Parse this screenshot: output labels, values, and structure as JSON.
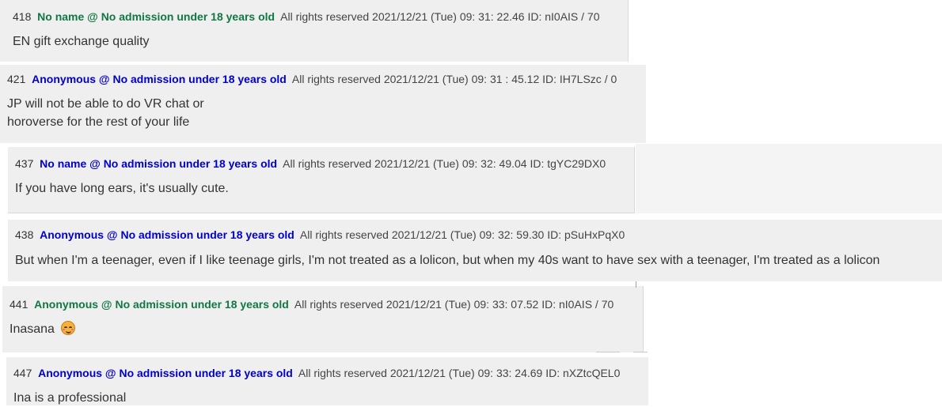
{
  "posts": [
    {
      "number": "418",
      "name": "No name @ No admission under 18 years old",
      "name_color": "#117743",
      "meta": "All rights reserved 2021/12/21 (Tue) 09: 31: 22.46  ID: nI0AIS / 70",
      "lines": [
        "EN gift exchange quality"
      ]
    },
    {
      "number": "421",
      "name": "Anonymous @ No admission under 18 years old",
      "name_color": "#0000cc",
      "meta": "All rights reserved 2021/12/21 (Tue) 09: 31  : 45.12 ID: IH7LSzc / 0",
      "lines": [
        "JP will not be able to do VR chat or",
        "horoverse for the rest of your life"
      ]
    },
    {
      "number": "437",
      "name": "No name @ No admission under 18 years old",
      "name_color": "#0000cc",
      "meta": "All rights reserved 2021/12/21 (Tue) 09: 32: 49.04  ID: tgYC29DX0",
      "lines": [
        "If you have long ears, it's usually cute."
      ]
    },
    {
      "number": "438",
      "name": "Anonymous @ No admission under 18 years old",
      "name_color": "#0000cc",
      "meta": "All rights reserved 2021/12/21 (Tue) 09: 32: 59.30  ID: pSuHxPqX0",
      "lines": [
        "But when I'm a teenager, even if I like teenage girls, I'm not treated as a lolicon, but when my 40s want to have sex with a teenager, I'm treated as a lolicon"
      ]
    },
    {
      "number": "441",
      "name": "Anonymous @ No admission under 18 years old",
      "name_color": "#117743",
      "meta": "All rights reserved 2021/12/21 (Tue) 09: 33: 07.52  ID: nI0AIS / 70",
      "lines": [
        "Inasana"
      ],
      "emoji": "smiling-face-with-hearts-icon"
    },
    {
      "number": "447",
      "name": "Anonymous @ No admission under 18 years old",
      "name_color": "#0000cc",
      "meta": "All rights reserved 2021/12/21 (Tue) 09: 33: 24.69  ID: nXZtcQEL0",
      "lines": [
        "Ina is a professional"
      ]
    }
  ]
}
